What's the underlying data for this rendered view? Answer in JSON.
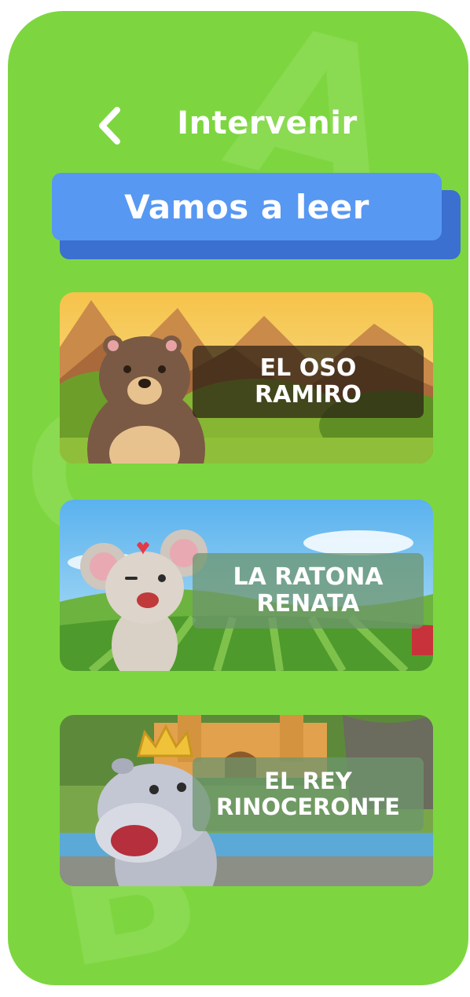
{
  "header": {
    "title": "Intervenir",
    "back_icon": "chevron-left-icon"
  },
  "banner": {
    "label": "Vamos a leer"
  },
  "stories": [
    {
      "title": "EL OSO RAMIRO",
      "line1": "EL OSO",
      "line2": "RAMIRO",
      "character": "bear"
    },
    {
      "title": "LA RATONA RENATA",
      "line1": "LA RATONA",
      "line2": "RENATA",
      "character": "mouse"
    },
    {
      "title": "EL REY RINOCERONTE",
      "line1": "EL REY",
      "line2": "RINOCERONTE",
      "character": "hippo-king"
    }
  ],
  "colors": {
    "background": "#7dd63f",
    "banner": "#5798f2",
    "banner_shadow": "#3b6fd0"
  }
}
